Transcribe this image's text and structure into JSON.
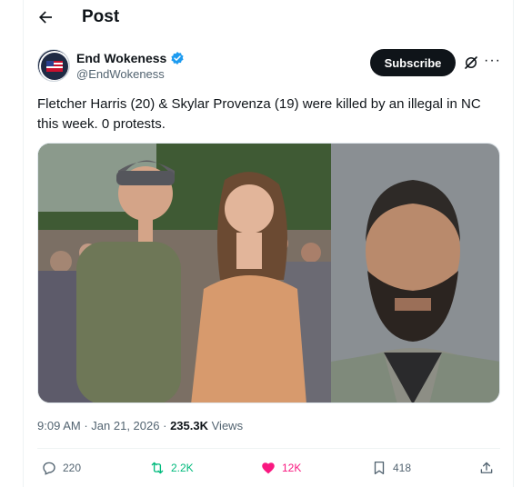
{
  "header": {
    "title": "Post"
  },
  "author": {
    "display_name": "End Wokeness",
    "handle": "@EndWokeness",
    "subscribe_label": "Subscribe"
  },
  "post": {
    "text": "Fletcher Harris (20) & Skylar Provenza (19) were killed by an illegal in NC this week. 0 protests."
  },
  "meta": {
    "time": "9:09 AM",
    "sep1": "·",
    "date": "Jan 21, 2026",
    "sep2": "·",
    "views_count": "235.3K",
    "views_label": "Views"
  },
  "actions": {
    "replies": "220",
    "reposts": "2.2K",
    "likes": "12K",
    "bookmarks": "418"
  },
  "colors": {
    "repost": "#00ba7c",
    "like": "#f91880",
    "verified": "#1d9bf0"
  }
}
